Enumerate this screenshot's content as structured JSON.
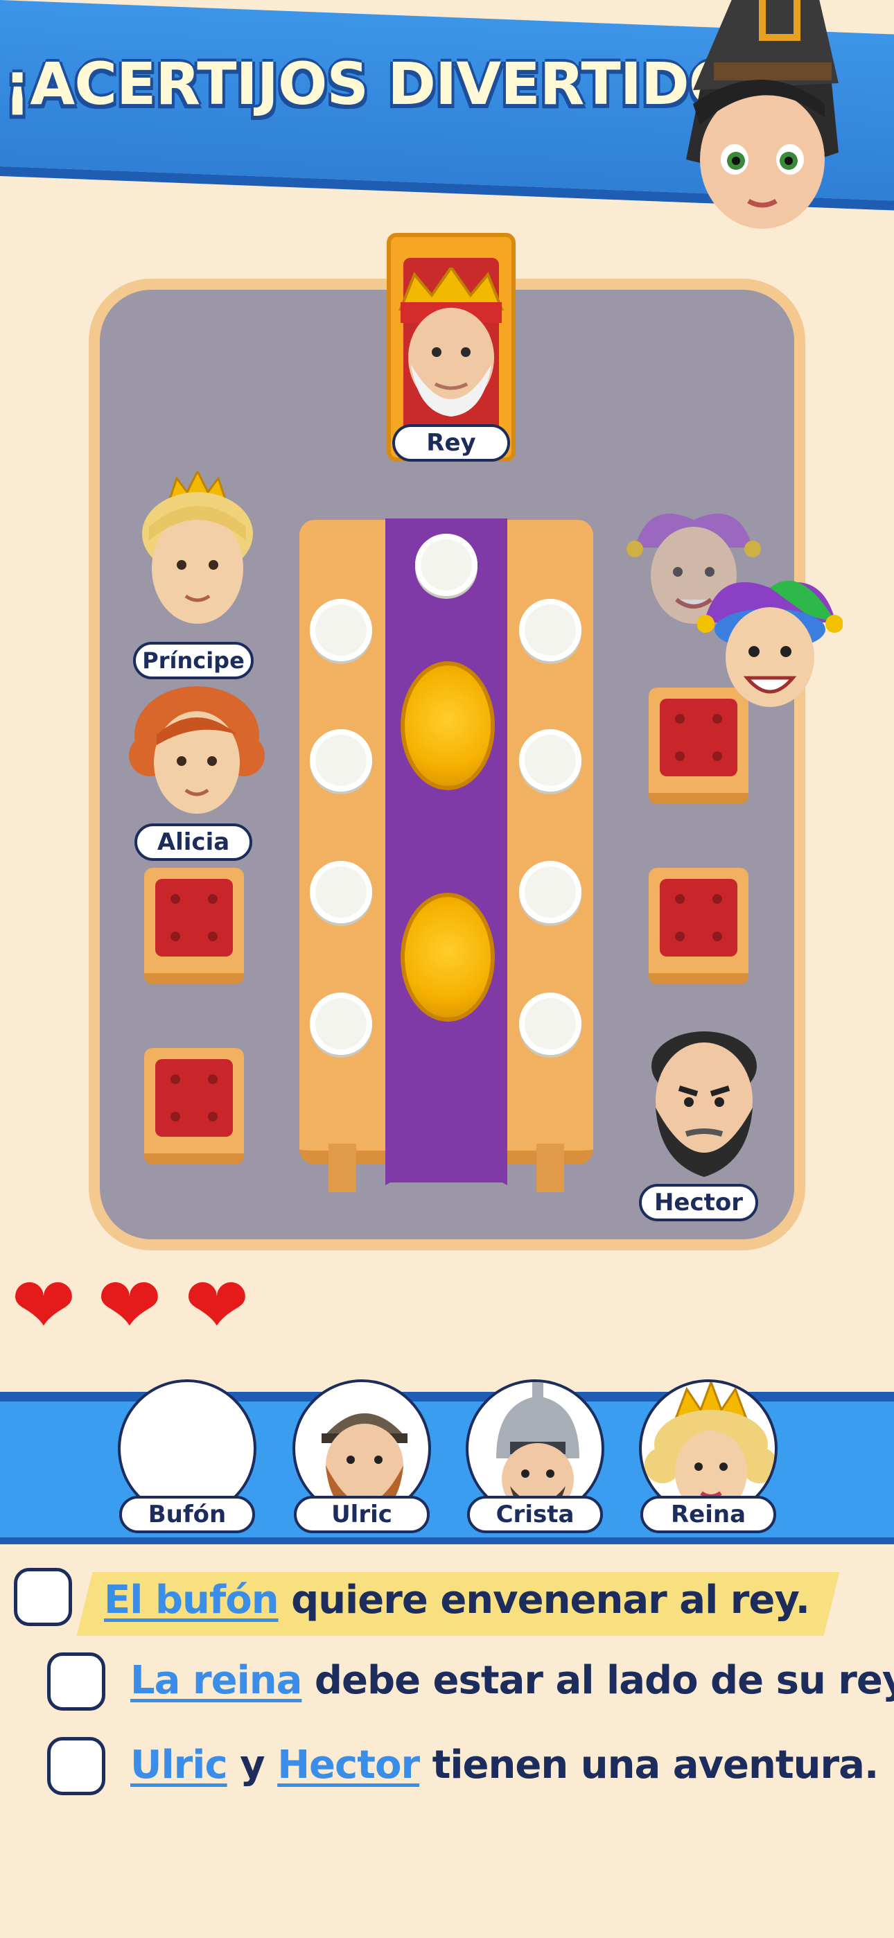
{
  "header": {
    "title": "¡ACERTIJOS DIVERTIDOS!",
    "mascot_icon": "witch-avatar"
  },
  "board": {
    "characters": [
      {
        "id": "king",
        "label": "Rey",
        "icon": "king-emoji"
      },
      {
        "id": "prince",
        "label": "Príncipe",
        "icon": "prince-emoji"
      },
      {
        "id": "alicia",
        "label": "Alicia",
        "icon": "redhead-woman-emoji"
      },
      {
        "id": "hector",
        "label": "Hector",
        "icon": "bearded-man-emoji"
      },
      {
        "id": "jester1",
        "label": "",
        "icon": "jester-emoji-ghost"
      },
      {
        "id": "jester2",
        "label": "",
        "icon": "jester-emoji"
      }
    ]
  },
  "lives": {
    "count": 3,
    "icon": "heart-icon"
  },
  "tray": {
    "items": [
      {
        "label": "Bufón",
        "icon": ""
      },
      {
        "label": "Ulric",
        "icon": "viking-emoji"
      },
      {
        "label": "Crista",
        "icon": "knight-emoji"
      },
      {
        "label": "Reina",
        "icon": "queen-emoji"
      }
    ]
  },
  "clues": [
    {
      "parts": [
        {
          "text": "El bufón",
          "hl": true
        },
        {
          "text": " quiere envenenar al rey.",
          "hl": false
        }
      ],
      "checked": false
    },
    {
      "parts": [
        {
          "text": "La reina",
          "hl": true
        },
        {
          "text": " debe estar al lado de su rey.",
          "hl": false
        }
      ],
      "checked": false
    },
    {
      "parts": [
        {
          "text": "Ulric",
          "hl": true
        },
        {
          "text": " y ",
          "hl": false
        },
        {
          "text": "Hector",
          "hl": true
        },
        {
          "text": " tienen una aventura.",
          "hl": false
        }
      ],
      "checked": false
    }
  ],
  "colors": {
    "background": "#fcebd3",
    "banner": "#3a9df0",
    "accent_text": "#3a8ee8",
    "dark_text": "#1c2c5c",
    "heart": "#e51b1b"
  }
}
